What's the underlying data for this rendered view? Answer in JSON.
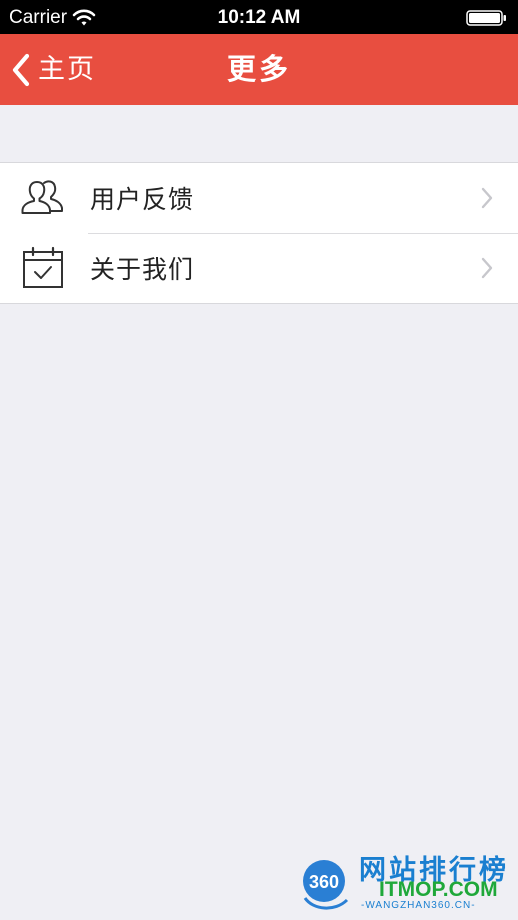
{
  "status_bar": {
    "carrier": "Carrier",
    "time": "10:12 AM"
  },
  "nav": {
    "back_label": "主页",
    "title": "更多"
  },
  "menu": {
    "items": [
      {
        "label": "用户反馈",
        "icon": "users-icon"
      },
      {
        "label": "关于我们",
        "icon": "calendar-check-icon"
      }
    ]
  },
  "watermark": {
    "badge": "360",
    "title": "网站排行榜",
    "domain": "ITMOP.COM",
    "sub": "-WANGZHAN360.CN-"
  },
  "colors": {
    "nav_background": "#e84e40",
    "page_background": "#efeff4",
    "status_bar": "#000000"
  }
}
